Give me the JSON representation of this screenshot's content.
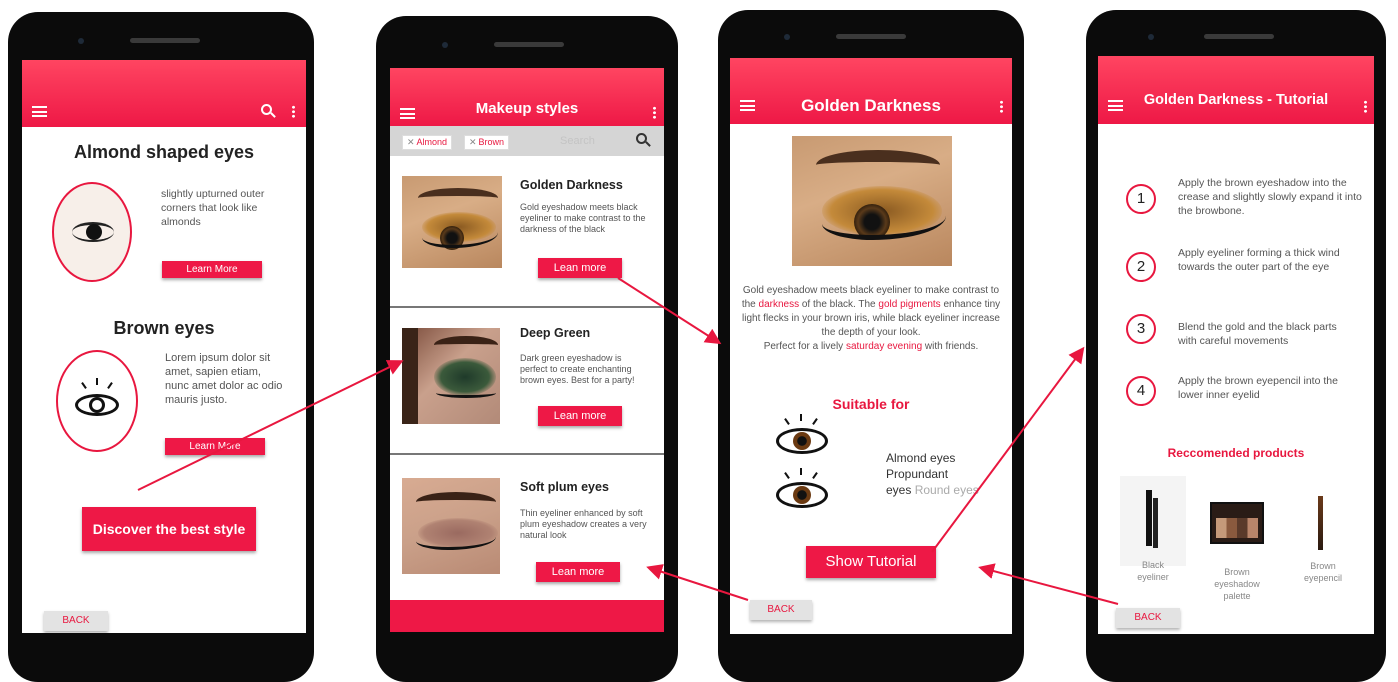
{
  "colors": {
    "accent": "#ee1846",
    "phone_body": "#0b0b0b",
    "back_button": "#e3e3e3"
  },
  "screen1": {
    "card1": {
      "title": "Almond shaped eyes",
      "description": "slightly upturned outer corners that look like almonds",
      "button": "Learn More"
    },
    "card2": {
      "title": "Brown eyes",
      "description": "Lorem ipsum dolor sit amet, sapien etiam, nunc amet dolor ac odio mauris justo.",
      "button": "Learn More"
    },
    "cta": "Discover the best style",
    "back": "BACK"
  },
  "screen2": {
    "title": "Makeup styles",
    "filters": [
      {
        "label": "Almond"
      },
      {
        "label": "Brown"
      }
    ],
    "search_placeholder": "Search",
    "styles": [
      {
        "title": "Golden Darkness",
        "description": "Gold eyeshadow meets black eyeliner to make  contrast to the darkness of the black",
        "button": "Lean more"
      },
      {
        "title": "Deep Green",
        "description": "Dark green eyeshadow is perfect to create enchanting brown eyes. Best for a party!",
        "button": "Lean more"
      },
      {
        "title": "Soft plum eyes",
        "description": "Thin eyeliner enhanced by soft plum eyeshadow creates a very natural look",
        "button": "Lean more"
      }
    ]
  },
  "screen3": {
    "title": "Golden Darkness",
    "description": {
      "p1": "Gold eyeshadow meets black eyeliner to make contrast to the ",
      "h1": "darkness",
      "p2": " of the black. The ",
      "h2": "gold pigments",
      "p3": " enhance tiny light flecks in your brown iris, while black eyeliner increase the depth of your look.",
      "p4": "Perfect for a lively ",
      "h3": "saturday evening",
      "p5": " with friends."
    },
    "suitable_heading": "Suitable for",
    "suitable_lines": [
      "Almond eyes",
      "Propundant",
      "eyes"
    ],
    "suitable_faded": "Round eyes",
    "button": "Show Tutorial",
    "back": "BACK"
  },
  "screen4": {
    "title": "Golden Darkness - Tutorial",
    "steps": [
      {
        "number": "1",
        "text": "Apply the brown eyeshadow into the crease and slightly slowly expand it into the browbone."
      },
      {
        "number": "2",
        "text": "Apply eyeliner forming a thick wind towards the outer part of the eye"
      },
      {
        "number": "3",
        "text": "Blend the gold and the black parts with careful movements"
      },
      {
        "number": "4",
        "text": "Apply the brown eyepencil into the lower inner eyelid"
      }
    ],
    "products_heading": "Reccomended products",
    "products": [
      {
        "name": "Black eyeliner"
      },
      {
        "name": "Brown eyeshadow palette"
      },
      {
        "name": "Brown eyepencil"
      }
    ],
    "back": "BACK"
  }
}
